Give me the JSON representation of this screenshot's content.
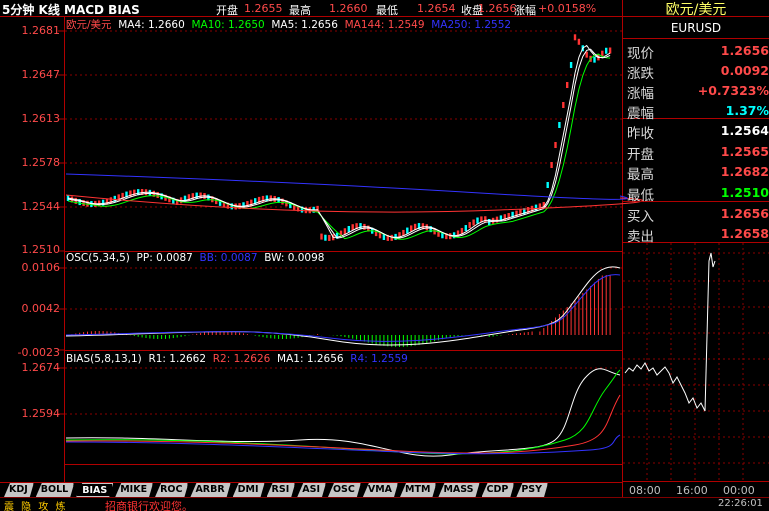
{
  "title": "5分钟 K线 MACD BIAS",
  "quote_bar": {
    "open_label": "开盘",
    "open": "1.2655",
    "high_label": "最高",
    "high": "1.2660",
    "low_label": "最低",
    "low": "1.2654",
    "close_label": "收盘",
    "close": "1.2656",
    "change_label": "涨幅",
    "change": "+0.0158%"
  },
  "main_legend": {
    "name": "欧元/美元",
    "ma4": "MA4: 1.2660",
    "ma10": "MA10: 1.2650",
    "ma5": "MA5: 1.2656",
    "ma144": "MA144: 1.2549",
    "ma250": "MA250: 1.2552"
  },
  "main_axis": [
    "1.2681",
    "1.2647",
    "1.2613",
    "1.2578",
    "1.2544",
    "1.2510"
  ],
  "osc_legend": {
    "osc": "OSC(5,34,5)",
    "pp": "PP: 0.0087",
    "bb": "BB: 0.0087",
    "bw": "BW: 0.0098"
  },
  "osc_axis": [
    "0.0106",
    "0.0042",
    "-0.0023"
  ],
  "bias_legend": {
    "bias": "BIAS(5,8,13,1)",
    "r1": "R1: 1.2662",
    "r2": "R2: 1.2626",
    "ma1": "MA1: 1.2656",
    "r4": "R4: 1.2559"
  },
  "bias_axis": [
    "1.2674",
    "1.2594"
  ],
  "side": {
    "name": "欧元/美元",
    "code": "EURUSD",
    "rows": [
      {
        "k": "现价",
        "v": "1.2656",
        "c": "#ff4a4a"
      },
      {
        "k": "涨跌",
        "v": "0.0092",
        "c": "#ff4a4a"
      },
      {
        "k": "涨幅",
        "v": "+0.7323%",
        "c": "#ff4a4a"
      },
      {
        "k": "震幅",
        "v": "1.37%",
        "c": "#00ffff"
      },
      {
        "k": "昨收",
        "v": "1.2564",
        "c": "#ffffff"
      },
      {
        "k": "开盘",
        "v": "1.2565",
        "c": "#ff4a4a"
      },
      {
        "k": "最高",
        "v": "1.2682",
        "c": "#ff4a4a"
      },
      {
        "k": "最低",
        "v": "1.2510",
        "c": "#00ff00"
      },
      {
        "k": "买入",
        "v": "1.2656",
        "c": "#ff4a4a"
      },
      {
        "k": "卖出",
        "v": "1.2658",
        "c": "#ff4a4a"
      }
    ],
    "time_axis": [
      "08:00",
      "16:00",
      "00:00"
    ]
  },
  "tabs": [
    "KDJ",
    "BOLL",
    "BIAS",
    "MIKE",
    "ROC",
    "ARBR",
    "DMI",
    "RSI",
    "ASI",
    "OSC",
    "VMA",
    "MTM",
    "MASS",
    "CDP",
    "PSY"
  ],
  "active_tab": "BIAS",
  "status": {
    "left": "震 隐 攻 炼",
    "ticker": "招商银行欢迎您。",
    "clock": "22:26:01"
  }
}
